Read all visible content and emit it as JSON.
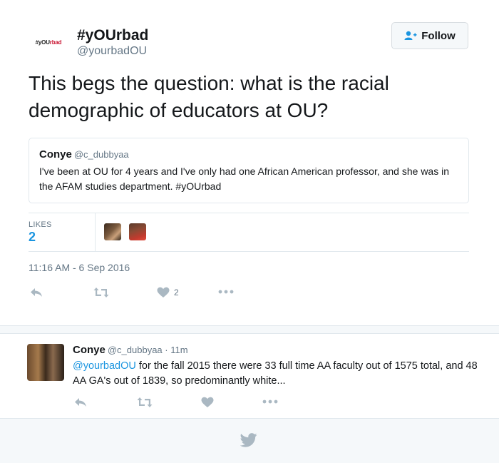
{
  "tweet": {
    "avatar_text_a": "#yOU",
    "avatar_text_b": "rbad",
    "author_name": "#yOUrbad",
    "author_handle": "@yourbadOU",
    "follow_label": "Follow",
    "text": "This begs the question: what is the racial demographic of educators at OU?",
    "quote": {
      "name": "Conye",
      "handle": "@c_dubbyaa",
      "text": "I've been at OU for 4 years and I've only had one African American professor, and she was in the AFAM studies department. #yOUrbad"
    },
    "likes_label": "LIKES",
    "likes_count": "2",
    "timestamp": "11:16 AM - 6 Sep 2016",
    "actions": {
      "like_count": "2"
    }
  },
  "reply": {
    "name": "Conye",
    "handle_time": "@c_dubbyaa · 11m",
    "mention": "@yourbadOU",
    "text": " for the fall 2015 there were 33 full time AA faculty out of 1575 total, and 48 AA GA's out of 1839, so predominantly white..."
  },
  "colors": {
    "accent": "#1b95e0",
    "muted": "#657786",
    "icon": "#aab8c2",
    "border": "#e1e8ed",
    "background_light": "#f5f8fa"
  },
  "icons": [
    "follow-person-icon",
    "reply-icon",
    "retweet-icon",
    "like-icon",
    "more-icon",
    "twitter-bird-icon"
  ]
}
